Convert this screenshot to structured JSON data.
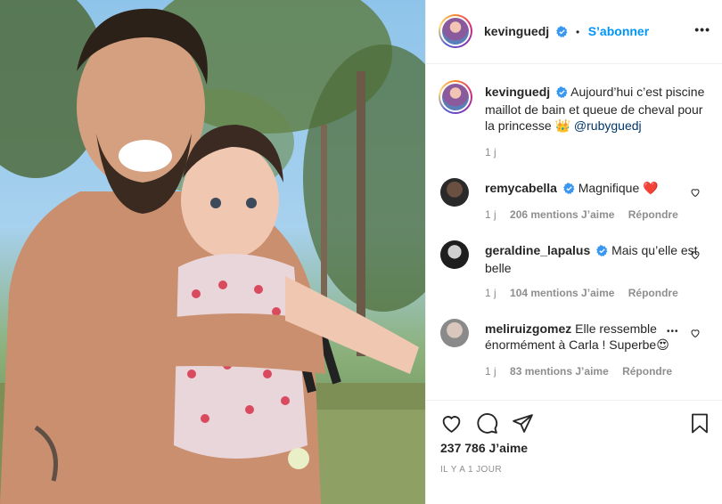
{
  "post": {
    "username": "kevinguedj",
    "dot": "•",
    "follow_label": "S’abonner",
    "more_label": "•••"
  },
  "caption": {
    "username": "kevinguedj",
    "text": "Aujourd’hui c’est piscine maillot de bain et queue de cheval pour la princesse 👑",
    "mention": "@rubyguedj",
    "time": "1 j"
  },
  "comments": [
    {
      "username": "remycabella",
      "verified": true,
      "text": "Magnifique ❤️",
      "time": "1 j",
      "likes": "206 mentions J’aime",
      "reply": "Répondre"
    },
    {
      "username": "geraldine_lapalus",
      "verified": true,
      "text": "Mais qu’elle est belle",
      "time": "1 j",
      "likes": "104 mentions J’aime",
      "reply": "Répondre"
    },
    {
      "username": "meliruizgomez",
      "verified": false,
      "text": "Elle ressemble énormément à Carla ! Superbe😍",
      "time": "1 j",
      "likes": "83 mentions J’aime",
      "reply": "Répondre",
      "more": "•••"
    }
  ],
  "footer": {
    "likes_count": "237 786 J’aime",
    "date": "IL Y A 1 JOUR"
  },
  "colors": {
    "link": "#0095f6",
    "verified": "#3897f0",
    "muted": "#8e8e8e",
    "text": "#262626"
  },
  "icons": [
    "heart-icon",
    "comment-icon",
    "share-icon",
    "bookmark-icon",
    "verified-badge-icon",
    "more-icon"
  ]
}
